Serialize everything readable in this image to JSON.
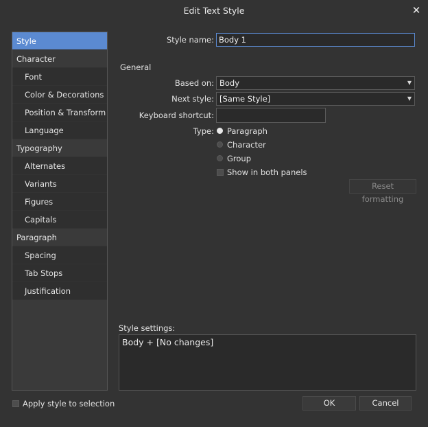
{
  "window": {
    "title": "Edit Text Style",
    "close_glyph": "✕"
  },
  "sidebar": {
    "items": [
      {
        "label": "Style",
        "sub": false,
        "selected": true
      },
      {
        "label": "Character",
        "sub": false
      },
      {
        "label": "Font",
        "sub": true
      },
      {
        "label": "Color & Decorations",
        "sub": true
      },
      {
        "label": "Position & Transform",
        "sub": true
      },
      {
        "label": "Language",
        "sub": true
      },
      {
        "label": "Typography",
        "sub": false
      },
      {
        "label": "Alternates",
        "sub": true
      },
      {
        "label": "Variants",
        "sub": true
      },
      {
        "label": "Figures",
        "sub": true
      },
      {
        "label": "Capitals",
        "sub": true
      },
      {
        "label": "Paragraph",
        "sub": false
      },
      {
        "label": "Spacing",
        "sub": true
      },
      {
        "label": "Tab Stops",
        "sub": true
      },
      {
        "label": "Justification",
        "sub": true
      }
    ]
  },
  "form": {
    "style_name_label": "Style name:",
    "style_name_value": "Body 1",
    "general_heading": "General",
    "based_on_label": "Based on:",
    "based_on_value": "Body",
    "next_style_label": "Next style:",
    "next_style_value": "[Same Style]",
    "shortcut_label": "Keyboard shortcut:",
    "shortcut_value": "",
    "type_label": "Type:",
    "type_options": [
      "Paragraph",
      "Character",
      "Group"
    ],
    "type_selected": "Paragraph",
    "show_both_label": "Show in both panels",
    "show_both_checked": false,
    "reset_label": "Reset formatting"
  },
  "settings": {
    "label": "Style settings:",
    "value": "Body + [No changes]"
  },
  "footer": {
    "apply_label": "Apply style to selection",
    "apply_checked": false,
    "ok_label": "OK",
    "cancel_label": "Cancel"
  },
  "colors": {
    "background": "#333333",
    "accent": "#5b8ad1",
    "field_bg": "#2a2a2a"
  },
  "icons": {
    "close": "close-icon",
    "dropdown": "chevron-down-icon"
  }
}
